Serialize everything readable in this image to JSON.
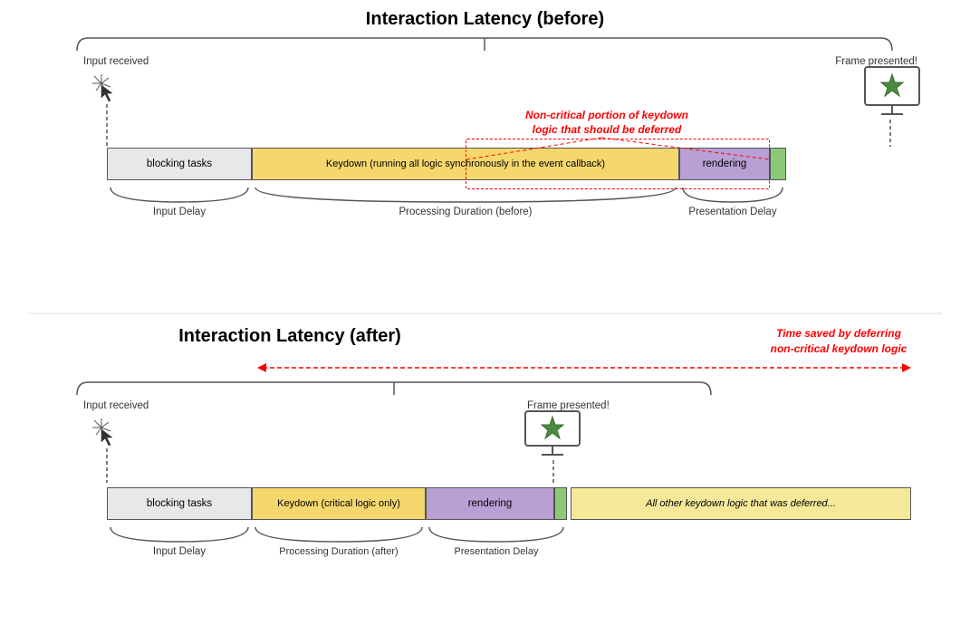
{
  "top": {
    "title": "Interaction Latency (before)",
    "input_received": "Input received",
    "frame_presented": "Frame presented!",
    "blocks": {
      "blocking_tasks": "blocking tasks",
      "keydown": "Keydown (running all logic synchronously in the event callback)",
      "rendering": "rendering"
    },
    "labels": {
      "input_delay": "Input Delay",
      "processing_duration": "Processing Duration (before)",
      "presentation_delay": "Presentation Delay"
    },
    "red_label": "Non-critical portion of keydown\nlogic that should be deferred"
  },
  "bottom": {
    "title": "Interaction Latency (after)",
    "input_received": "Input received",
    "frame_presented": "Frame presented!",
    "blocks": {
      "blocking_tasks": "blocking tasks",
      "keydown": "Keydown (critical logic only)",
      "rendering": "rendering",
      "deferred": "All other keydown logic that was deferred..."
    },
    "labels": {
      "input_delay": "Input Delay",
      "processing_duration": "Processing Duration (after)",
      "presentation_delay": "Presentation Delay"
    },
    "time_saved": "Time saved by deferring\nnon-critical keydown logic"
  }
}
